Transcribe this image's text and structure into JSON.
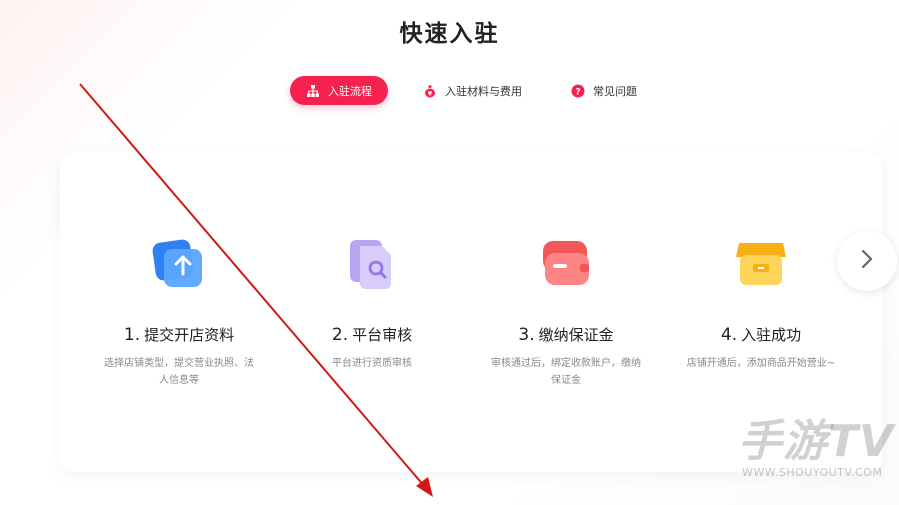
{
  "page": {
    "title": "快速入驻"
  },
  "tabs": [
    {
      "label": "入驻流程",
      "icon": "org-chart-icon",
      "active": true
    },
    {
      "label": "入驻材料与费用",
      "icon": "money-bag-icon",
      "active": false
    },
    {
      "label": "常见问题",
      "icon": "question-icon",
      "active": false
    }
  ],
  "steps": [
    {
      "num": "1.",
      "title": "提交开店资料",
      "desc": "选择店铺类型，提交营业执照、法人信息等",
      "icon": "upload-icon"
    },
    {
      "num": "2.",
      "title": "平台审核",
      "desc": "平台进行资质审核",
      "icon": "document-search-icon"
    },
    {
      "num": "3.",
      "title": "缴纳保证金",
      "desc": "审核通过后，绑定收款账户，缴纳保证金",
      "icon": "wallet-icon"
    },
    {
      "num": "4.",
      "title": "入驻成功",
      "desc": "店铺开通后，添加商品开始营业~",
      "icon": "store-icon"
    }
  ],
  "next_button": {
    "icon": "chevron-right-icon"
  },
  "watermark": {
    "text": "手游TV",
    "url": "WWW.SHOUYOUTV.COM"
  },
  "colors": {
    "accent": "#f5224f",
    "arrow": "#d01818"
  }
}
